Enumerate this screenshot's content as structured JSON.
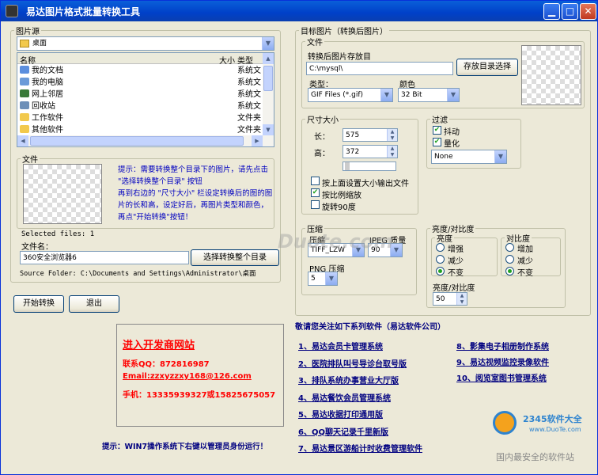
{
  "window": {
    "title": "易达图片格式批量转换工具"
  },
  "source": {
    "legend": "图片源",
    "drive": "桌面",
    "col_name": "名称",
    "col_size": "大小",
    "col_type": "类型",
    "items": [
      {
        "name": "我的文档",
        "type": "系统文"
      },
      {
        "name": "我的电脑",
        "type": "系统文"
      },
      {
        "name": "网上邻居",
        "type": "系统文"
      },
      {
        "name": "回收站",
        "type": "系统文"
      },
      {
        "name": "工作软件",
        "type": "文件夹"
      },
      {
        "name": "其他软件",
        "type": "文件夹"
      }
    ],
    "file_legend": "文件",
    "hint": "提示：需要转换整个目录下的图片，请先点击 \"选择转换整个目录\" 按钮\n再到右边的 \"尺寸大小\" 栏设定转换后的图的图片的长和高，设定好后，再图片类型和颜色，再点\"开始转换\"按钮！",
    "selected_files": "Selected files: 1",
    "filename_label": "文件名：",
    "filename_value": "360安全浏览器6",
    "select_dir_button": "选择转换整个目录",
    "source_folder": "Source Folder: C:\\Documents and Settings\\Administrator\\桌面"
  },
  "actions": {
    "start": "开始转换",
    "exit": "退出"
  },
  "target": {
    "legend": "目标图片（转换后图片）",
    "file_legend": "文件",
    "save_dir_label": "转换后图片存放目",
    "save_dir_value": "C:\\mysql\\",
    "save_dir_button": "存放目录选择",
    "type_label": "类型：",
    "type_value": "GIF Files (*.gif)",
    "color_label": "颜色",
    "color_value": "32 Bit"
  },
  "size": {
    "legend": "尺寸大小",
    "width_label": "长：",
    "width_value": "575",
    "height_label": "高：",
    "height_value": "372",
    "opt1": "按上面设置大小输出文件",
    "opt2": "按比例缩放",
    "opt3": "旋转90度",
    "opt1_checked": false,
    "opt2_checked": true,
    "opt3_checked": false
  },
  "filter": {
    "legend": "过滤",
    "dither": "抖动",
    "quantize": "量化",
    "dither_checked": true,
    "quantize_checked": true,
    "mode_value": "None"
  },
  "compress": {
    "legend": "压缩",
    "tiff_label": "压缩",
    "tiff_value": "TIFF_LZW",
    "jpeg_label": "JPEG 质量",
    "jpeg_value": "90",
    "png_label": "PNG 压缩",
    "png_value": "5"
  },
  "bc": {
    "legend": "亮度/对比度",
    "brightness_legend": "亮度",
    "contrast_legend": "对比度",
    "b_opts": [
      "增强",
      "减少",
      "不变"
    ],
    "c_opts": [
      "增加",
      "减少",
      "不变"
    ],
    "b_selected": 2,
    "c_selected": 2,
    "level_label": "亮度/对比度",
    "level_value": "50"
  },
  "promo": {
    "title": "进入开发商网站",
    "qq": "联系QQ：872816987",
    "email": "Email:zzxyzzxy168@126.com",
    "phone": "手机：13335939327或15825675057",
    "tip": "提示：WIN7操作系统下右键以管理员身份运行！"
  },
  "products": {
    "heading": "敬请您关注如下系列软件（易达软件公司）",
    "left": [
      "1、易达会员卡管理系统",
      "2、医院排队叫号导诊台取号版",
      "3、排队系统办事营业大厅版",
      "4、易达餐饮会员管理系统",
      "5、易达收据打印通用版",
      "6、QQ聊天记录千里新版",
      "7、易达景区游船计时收费管理软件"
    ],
    "right": [
      "8、影集电子相册制作系统",
      "9、易达视频监控录像软件",
      "10、阅览室图书管理系统"
    ]
  },
  "watermark": {
    "main": "Duote.com",
    "badge": "2345软件大全",
    "badge_url": "www.DuoTe.com",
    "footer": "国内最安全的软件站"
  }
}
